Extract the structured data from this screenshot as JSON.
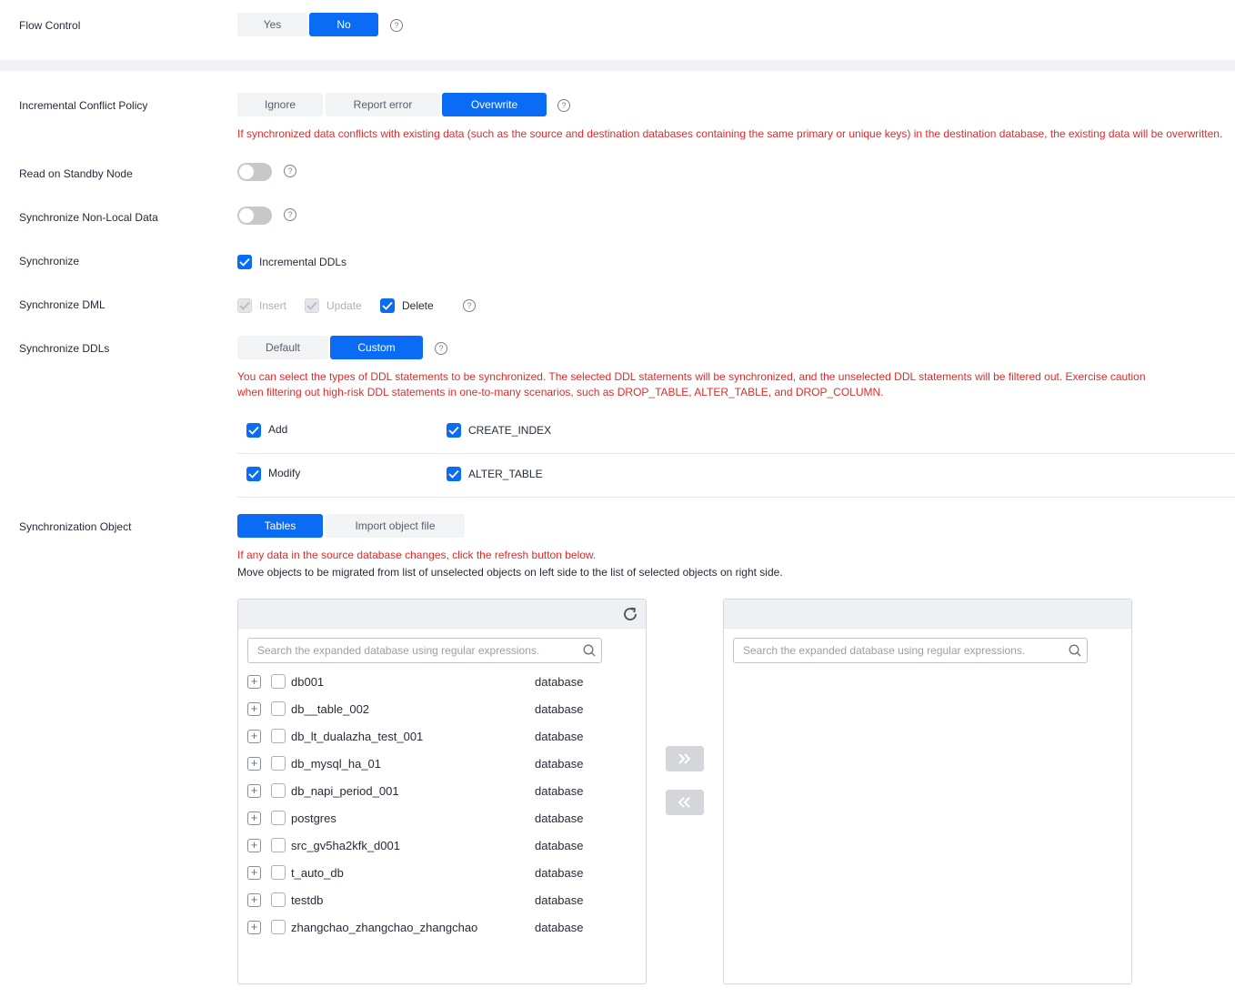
{
  "flow_control": {
    "label": "Flow Control",
    "options": [
      "Yes",
      "No"
    ],
    "selected": "No"
  },
  "conflict_policy": {
    "label": "Incremental Conflict Policy",
    "options": [
      "Ignore",
      "Report error",
      "Overwrite"
    ],
    "selected": "Overwrite",
    "warning": "If synchronized data conflicts with existing data (such as the source and destination databases containing the same primary or unique keys) in the destination database, the existing data will be overwritten."
  },
  "read_standby": {
    "label": "Read on Standby Node",
    "enabled": false
  },
  "sync_nonlocal": {
    "label": "Synchronize Non-Local Data",
    "enabled": false
  },
  "synchronize": {
    "label": "Synchronize",
    "option": "Incremental DDLs",
    "checked": true
  },
  "sync_dml": {
    "label": "Synchronize DML",
    "options": [
      {
        "label": "Insert",
        "checked": true,
        "disabled": true
      },
      {
        "label": "Update",
        "checked": true,
        "disabled": true
      },
      {
        "label": "Delete",
        "checked": true,
        "disabled": false
      }
    ]
  },
  "sync_ddls": {
    "label": "Synchronize DDLs",
    "options": [
      "Default",
      "Custom"
    ],
    "selected": "Custom",
    "warning_line1": "You can select the types of DDL statements to be synchronized. The selected DDL statements will be synchronized, and the unselected DDL statements will be filtered out. Exercise caution",
    "warning_line2": "when filtering out high-risk DDL statements in one-to-many scenarios, such as DROP_TABLE, ALTER_TABLE, and DROP_COLUMN.",
    "ddl_types": [
      {
        "left": "Add",
        "right": "CREATE_INDEX"
      },
      {
        "left": "Modify",
        "right": "ALTER_TABLE"
      }
    ]
  },
  "sync_object": {
    "label": "Synchronization Object",
    "options": [
      "Tables",
      "Import object file"
    ],
    "selected": "Tables",
    "warning": "If any data in the source database changes, click the refresh button below.",
    "note": "Move objects to be migrated from list of unselected objects on left side to the list of selected objects on right side.",
    "search_placeholder": "Search the expanded database using regular expressions.",
    "databases": [
      {
        "name": "db001",
        "type": "database"
      },
      {
        "name": "db__table_002",
        "type": "database"
      },
      {
        "name": "db_lt_dualazha_test_001",
        "type": "database"
      },
      {
        "name": "db_mysql_ha_01",
        "type": "database"
      },
      {
        "name": "db_napi_period_001",
        "type": "database"
      },
      {
        "name": "postgres",
        "type": "database"
      },
      {
        "name": "src_gv5ha2kfk_d001",
        "type": "database"
      },
      {
        "name": "t_auto_db",
        "type": "database"
      },
      {
        "name": "testdb",
        "type": "database"
      },
      {
        "name": "zhangchao_zhangchao_zhangchao",
        "type": "database"
      }
    ]
  },
  "colors": {
    "primary": "#0a6cf5",
    "warning": "#e02a2a"
  }
}
